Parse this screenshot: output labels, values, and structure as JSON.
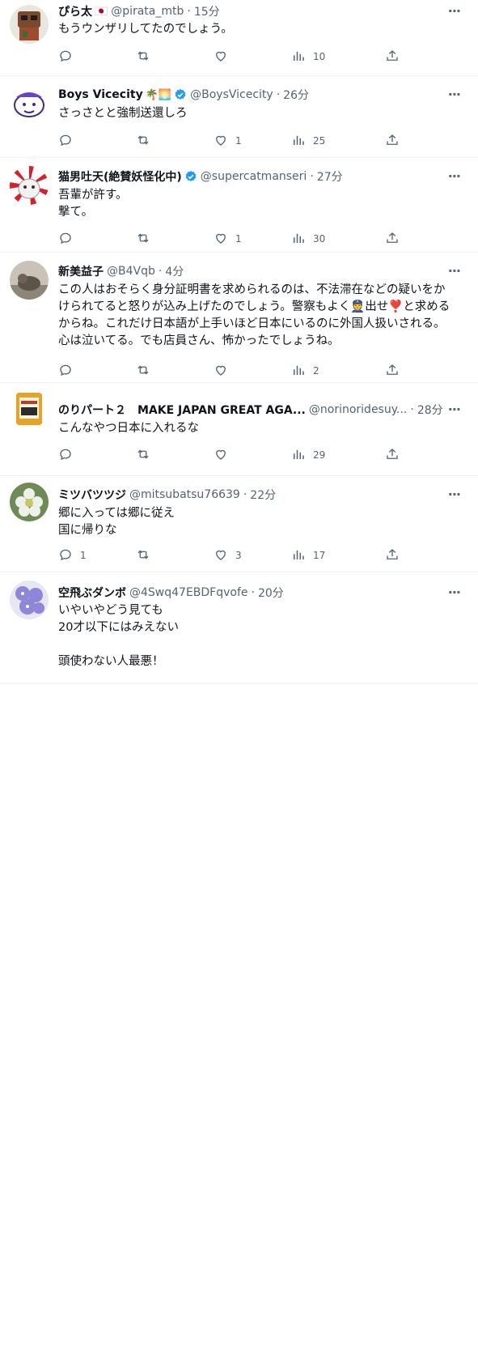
{
  "tweets": [
    {
      "name": "ぴら太",
      "name_suffix": "🇯🇵",
      "verified": false,
      "handle": "@pirata_mtb",
      "time": "15分",
      "lines": [
        "もうウンザリしてたのでしょう。"
      ],
      "replies": "",
      "retweets": "",
      "likes": "",
      "views": "10",
      "avatar": "robot"
    },
    {
      "name": "Boys Vicecity",
      "name_suffix": "🌴🌅",
      "verified": true,
      "handle": "@BoysVicecity",
      "time": "26分",
      "lines": [
        "さっさとと強制送還しろ"
      ],
      "replies": "",
      "retweets": "",
      "likes": "1",
      "views": "25",
      "avatar": "face-sketch"
    },
    {
      "name": "猫男吐天(絶賛妖怪化中)",
      "name_suffix": "",
      "verified": true,
      "handle": "@supercatmanseri",
      "time": "27分",
      "lines": [
        "吾輩が許す。",
        "撃て。"
      ],
      "replies": "",
      "retweets": "",
      "likes": "1",
      "views": "30",
      "avatar": "cat-sunburst"
    },
    {
      "name": "新美益子",
      "name_suffix": "",
      "verified": false,
      "handle": "@B4Vqb",
      "time": "4分",
      "lines": [
        "この人はおそらく身分証明書を求められるのは、不法滞在などの疑いをか",
        "けられてると怒りが込み上げたのでしょう。警察もよく👮出せ❣️と求める",
        "からね。これだけ日本語が上手いほど日本にいるのに外国人扱いされる。",
        "心は泣いてる。でも店員さん、怖かったでしょうね。"
      ],
      "replies": "",
      "retweets": "",
      "likes": "",
      "views": "2",
      "avatar": "cat-photo"
    },
    {
      "name": "のりパート２　MAKE JAPAN GREAT AGA...",
      "name_suffix": "",
      "verified": false,
      "handle": "@norinoridesuy...",
      "time": "28分",
      "lines": [
        "こんなやつ日本に入れるな"
      ],
      "replies": "",
      "retweets": "",
      "likes": "",
      "views": "29",
      "avatar": "book"
    },
    {
      "name": "ミツバツツジ",
      "name_suffix": "",
      "verified": false,
      "handle": "@mitsubatsu76639",
      "time": "22分",
      "lines": [
        "郷に入っては郷に従え",
        "国に帰りな"
      ],
      "replies": "1",
      "retweets": "",
      "likes": "3",
      "views": "17",
      "avatar": "flower-white"
    },
    {
      "name": "空飛ぶダンボ",
      "name_suffix": "",
      "verified": false,
      "handle": "@4Swq47EBDFqvofe",
      "time": "20分",
      "lines": [
        "いやいやどう見ても",
        "20才以下にはみえない",
        "",
        "頭使わない人最悪！"
      ],
      "replies": "",
      "retweets": "",
      "likes": "",
      "views": "",
      "avatar": "flower-purple"
    }
  ],
  "colors": {
    "text": "#0f1419",
    "secondary": "#536471",
    "verified": "#1d9bf0",
    "border": "#eff3f4"
  },
  "icons": {
    "reply": "reply-icon",
    "retweet": "retweet-icon",
    "like": "like-icon",
    "views": "views-icon",
    "share": "share-icon",
    "more": "more-icon"
  }
}
